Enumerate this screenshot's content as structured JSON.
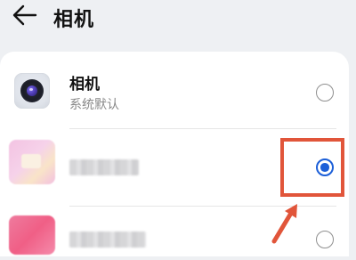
{
  "header": {
    "back_icon": "back-arrow-icon",
    "title": "相机"
  },
  "apps": [
    {
      "name": "相机",
      "subtitle": "系统默认",
      "icon": "camera-app-icon",
      "selected": false
    },
    {
      "name": "",
      "subtitle": "",
      "icon": "app-icon-pink",
      "selected": true
    },
    {
      "name": "",
      "subtitle": "",
      "icon": "app-icon-red",
      "selected": false
    }
  ],
  "colors": {
    "accent": "#1c5fd8",
    "annotation": "#e1553a",
    "background": "#eef0f3",
    "card": "#ffffff"
  }
}
